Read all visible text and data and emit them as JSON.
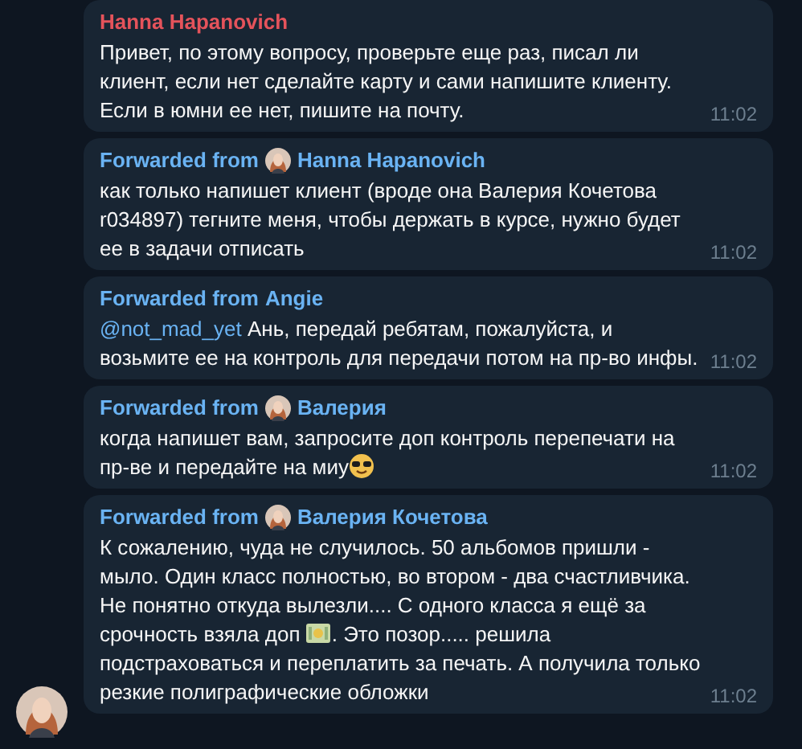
{
  "messages": [
    {
      "kind": "plain",
      "sender": "Hanna Hapanovich",
      "color": "#e5535b",
      "parts": [
        {
          "kind": "text",
          "text": "Привет, по этому вопросу, проверьте еще раз, писал ли клиент, если нет сделайте карту и сами напишите клиенту. Если в юмни ее нет, пишите на почту."
        }
      ],
      "time": "11:02"
    },
    {
      "kind": "forwarded",
      "prefix": "Forwarded from",
      "sender": "Hanna Hapanovich",
      "avatar": true,
      "color": "#6ab3f3",
      "parts": [
        {
          "kind": "text",
          "text": "как только напишет клиент (вроде она Валерия Кочетова r034897) тегните меня, чтобы держать в курсе, нужно будет ее в задачи отписать"
        }
      ],
      "time": "11:02"
    },
    {
      "kind": "forwarded",
      "prefix": "Forwarded from",
      "sender": "Angie",
      "avatar": false,
      "color": "#6ab3f3",
      "parts": [
        {
          "kind": "mention",
          "text": "@not_mad_yet"
        },
        {
          "kind": "text",
          "text": " Ань, передай ребятам, пожалуйста, и возьмите ее на контроль для передачи потом на пр-во инфы."
        }
      ],
      "time": "11:02"
    },
    {
      "kind": "forwarded",
      "prefix": "Forwarded from",
      "sender": "Валерия",
      "avatar": true,
      "color": "#6ab3f3",
      "parts": [
        {
          "kind": "text",
          "text": "когда напишет вам, запросите доп контроль перепечати на пр-ве и передайте на миу"
        },
        {
          "kind": "emoji_sunglasses"
        }
      ],
      "time": "11:02"
    },
    {
      "kind": "forwarded",
      "prefix": "Forwarded from",
      "sender": "Валерия Кочетова",
      "avatar": true,
      "color": "#6ab3f3",
      "parts": [
        {
          "kind": "text",
          "text": "К сожалению, чуда не случилось. 50 альбомов пришли - мыло. Один класс полностью, во втором - два счастливчика. Не понятно откуда вылезли.... С одного класса я ещё за срочность взяла доп "
        },
        {
          "kind": "emoji_money"
        },
        {
          "kind": "text",
          "text": ". Это позор..... решила подстраховаться и переплатить за печать. А получила только резкие полиграфические обложки"
        }
      ],
      "time": "11:02"
    }
  ]
}
